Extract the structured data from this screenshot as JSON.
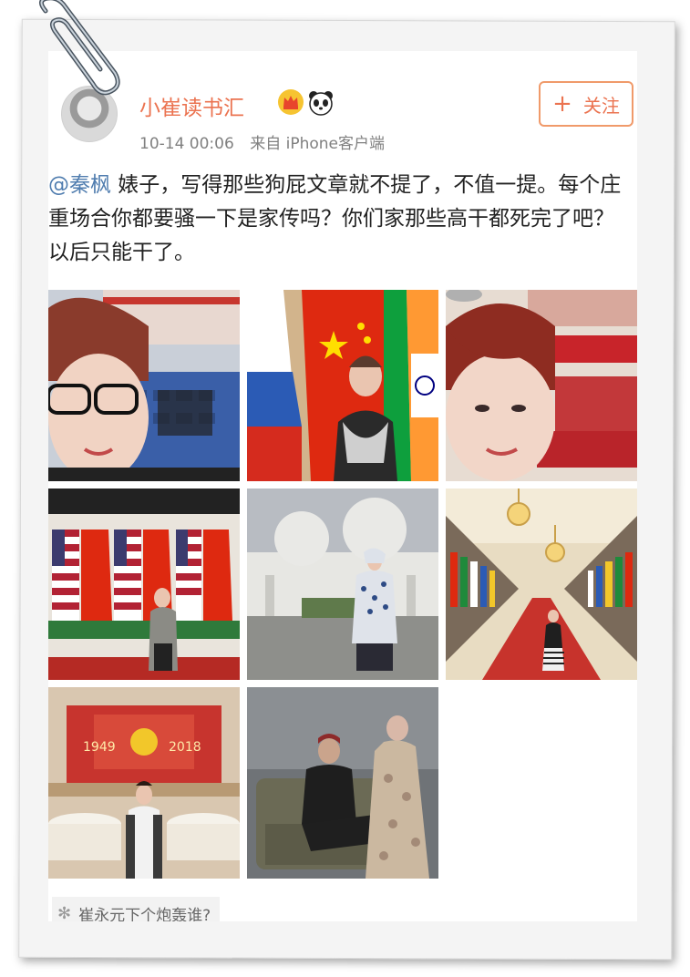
{
  "post": {
    "username": "小崔读书汇",
    "timestamp": "10-14 00:06",
    "source": "来自 iPhone客户端",
    "follow_label": "关注",
    "mention": "@秦枫",
    "text": " 婊子，写得那些狗屁文章就不提了，不值一提。每个庄重场合你都要骚一下是家传吗？你们家那些高干都死完了吧？以后只能干了。"
  },
  "photos": [
    {
      "label": "photo-1"
    },
    {
      "label": "photo-2"
    },
    {
      "label": "photo-3"
    },
    {
      "label": "photo-4"
    },
    {
      "label": "photo-5"
    },
    {
      "label": "photo-6"
    },
    {
      "label": "photo-7",
      "caption_left": "1949",
      "caption_right": "2018"
    },
    {
      "label": "photo-8"
    }
  ],
  "hashtag": {
    "text": "崔永元下个炮轰谁?"
  },
  "colors": {
    "username": "#eb7350",
    "mention": "#507daf",
    "follow_border": "#f09a6a"
  },
  "icons": [
    "paperclip-icon",
    "crown-icon",
    "panda-icon",
    "plus-icon",
    "topic-icon"
  ]
}
